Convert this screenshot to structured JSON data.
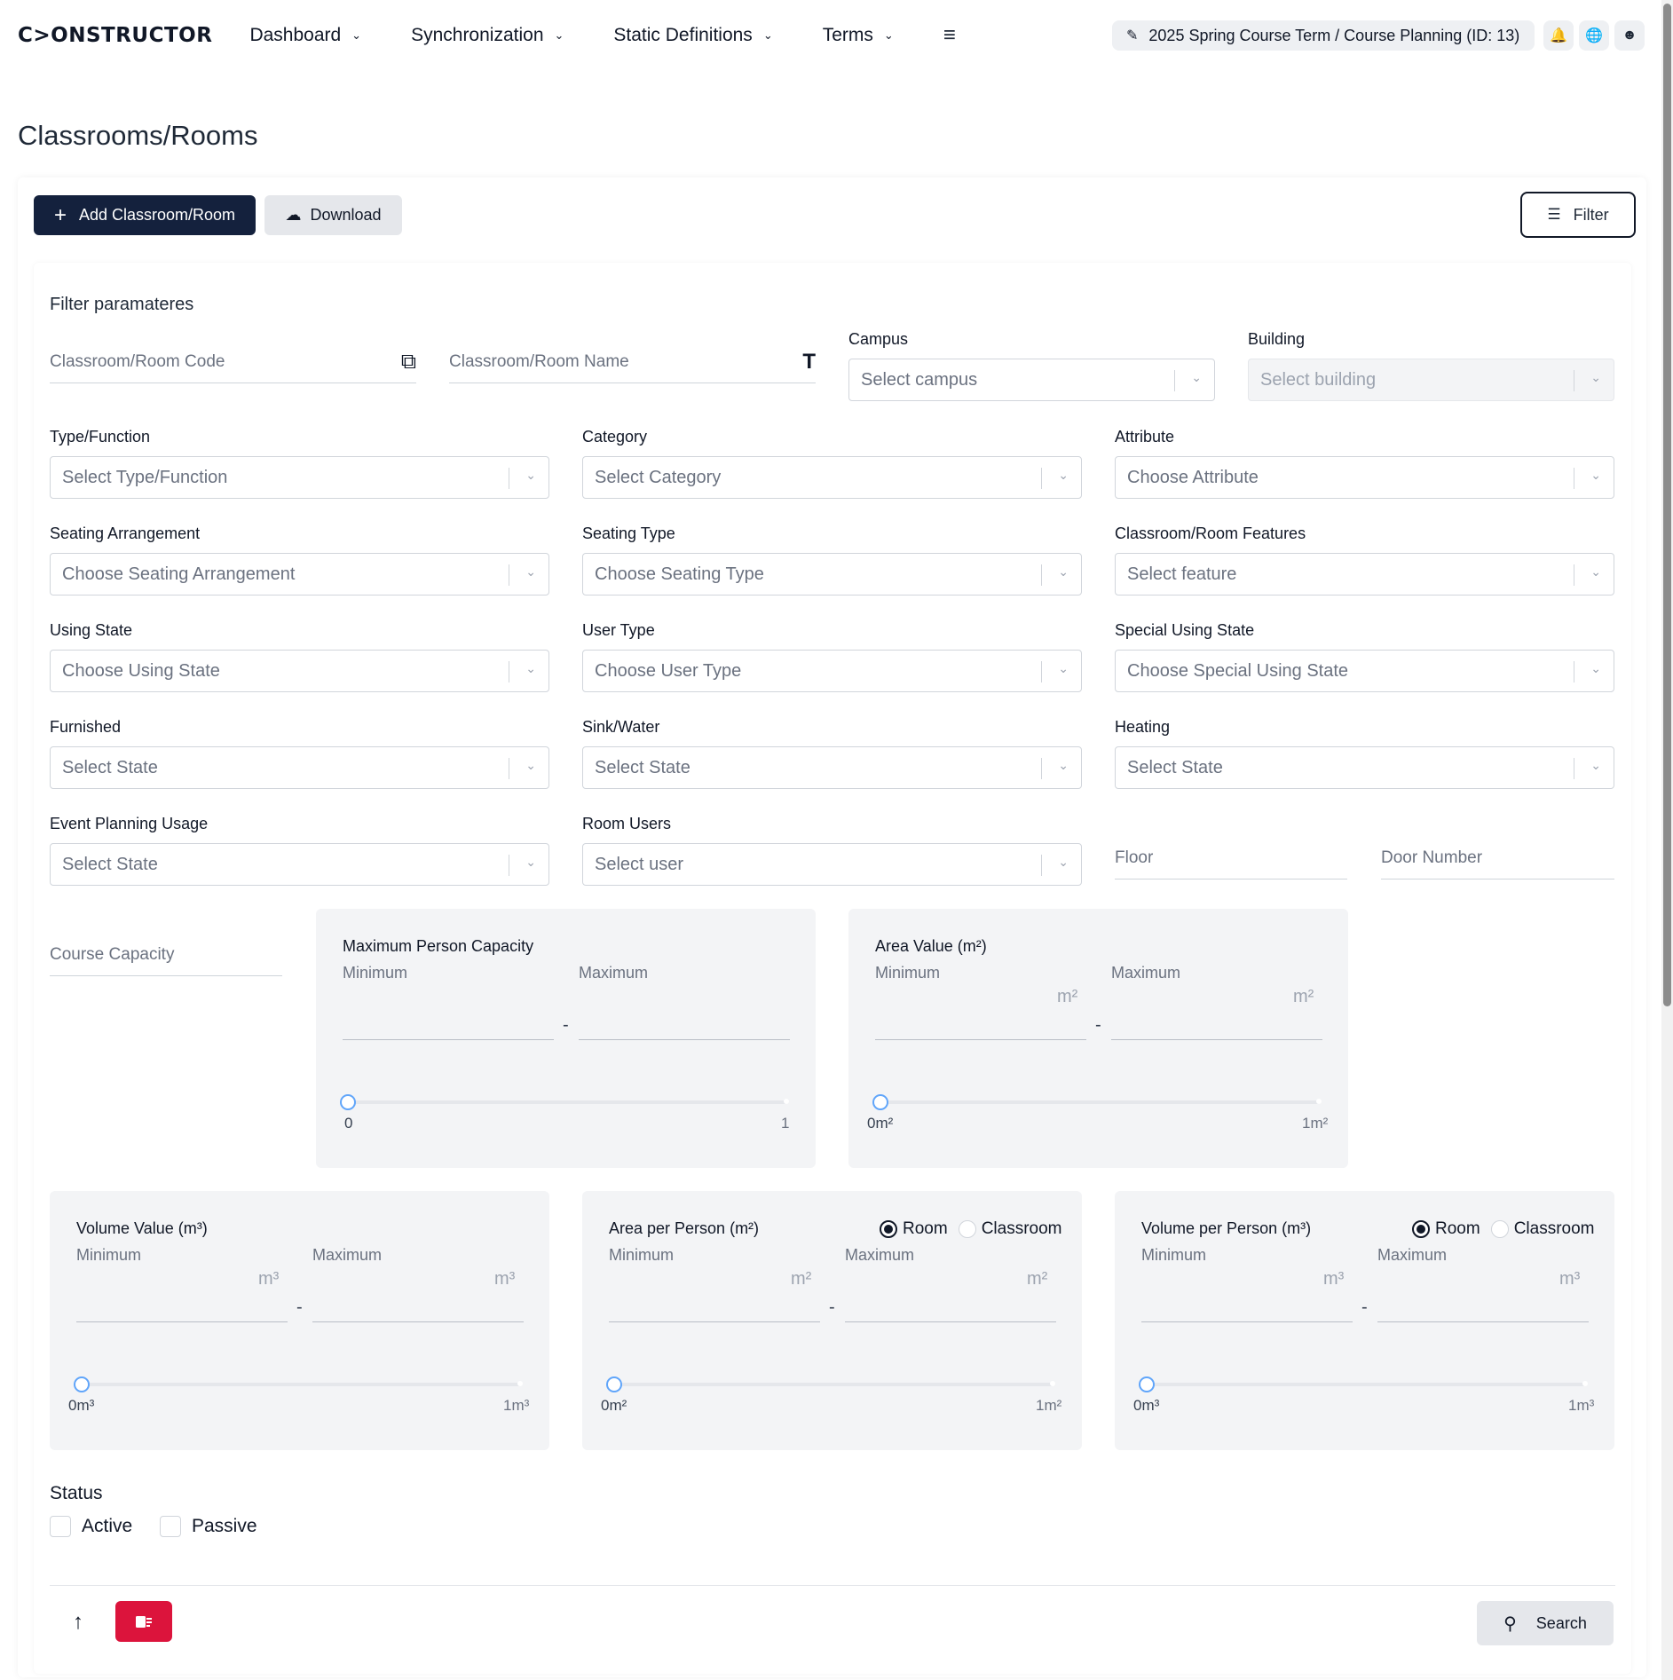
{
  "nav": {
    "logo": "C>ONSTRUCTOR",
    "items": [
      {
        "label": "Dashboard"
      },
      {
        "label": "Synchronization"
      },
      {
        "label": "Static Definitions"
      },
      {
        "label": "Terms"
      }
    ],
    "term": "2025 Spring Course Term / Course Planning (ID: 13)",
    "icons": [
      "menu-icon",
      "edit-icon",
      "bell-icon",
      "globe-icon",
      "user-icon"
    ]
  },
  "page": {
    "title": "Classrooms/Rooms"
  },
  "toolbar": {
    "add_label": "Add Classroom/Room",
    "download_label": "Download",
    "filter_label": "Filter"
  },
  "filters": {
    "title": "Filter paramateres",
    "code_placeholder": "Classroom/Room Code",
    "name_placeholder": "Classroom/Room Name",
    "campus": {
      "label": "Campus",
      "placeholder": "Select campus"
    },
    "building": {
      "label": "Building",
      "placeholder": "Select building"
    },
    "type": {
      "label": "Type/Function",
      "placeholder": "Select Type/Function"
    },
    "category": {
      "label": "Category",
      "placeholder": "Select Category"
    },
    "attribute": {
      "label": "Attribute",
      "placeholder": "Choose Attribute"
    },
    "seating_arrangement": {
      "label": "Seating Arrangement",
      "placeholder": "Choose Seating Arrangement"
    },
    "seating_type": {
      "label": "Seating Type",
      "placeholder": "Choose Seating Type"
    },
    "features": {
      "label": "Classroom/Room Features",
      "placeholder": "Select feature"
    },
    "using_state": {
      "label": "Using State",
      "placeholder": "Choose Using State"
    },
    "user_type": {
      "label": "User Type",
      "placeholder": "Choose User Type"
    },
    "special_using_state": {
      "label": "Special Using State",
      "placeholder": "Choose Special Using State"
    },
    "furnished": {
      "label": "Furnished",
      "placeholder": "Select State"
    },
    "sink": {
      "label": "Sink/Water",
      "placeholder": "Select State"
    },
    "heating": {
      "label": "Heating",
      "placeholder": "Select State"
    },
    "event_usage": {
      "label": "Event Planning Usage",
      "placeholder": "Select State"
    },
    "room_users": {
      "label": "Room Users",
      "placeholder": "Select user"
    },
    "floor_placeholder": "Floor",
    "door_placeholder": "Door Number",
    "course_capacity_placeholder": "Course Capacity",
    "min_label": "Minimum",
    "max_label": "Maximum",
    "dash": "-",
    "max_person": {
      "title": "Maximum Person Capacity",
      "low": "0",
      "high": "1"
    },
    "area": {
      "title": "Area Value (m²)",
      "unit": "m²",
      "low": "0m²",
      "high": "1m²"
    },
    "volume": {
      "title": "Volume Value (m³)",
      "unit": "m³",
      "low": "0m³",
      "high": "1m³"
    },
    "area_per_person": {
      "title": "Area per Person (m²)",
      "unit": "m²",
      "low": "0m²",
      "high": "1m²",
      "opt_room": "Room",
      "opt_classroom": "Classroom",
      "selected": "Room"
    },
    "volume_per_person": {
      "title": "Volume per Person (m³)",
      "unit": "m³",
      "low": "0m³",
      "high": "1m³",
      "opt_room": "Room",
      "opt_classroom": "Classroom",
      "selected": "Room"
    },
    "status": {
      "title": "Status",
      "active": "Active",
      "passive": "Passive"
    }
  },
  "footer": {
    "search_label": "Search"
  }
}
